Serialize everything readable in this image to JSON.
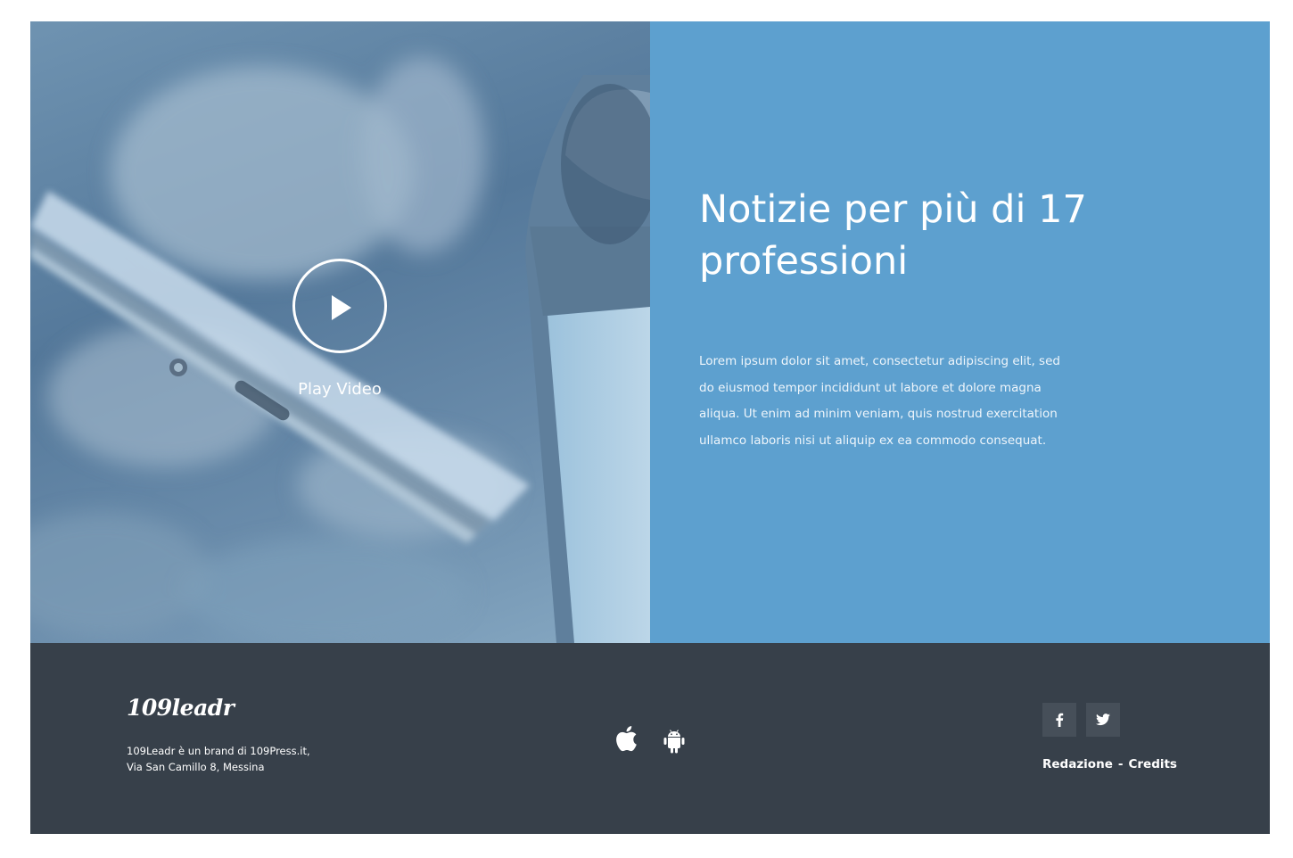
{
  "hero": {
    "play_label": "Play Video",
    "headline": "Notizie per più di 17 professioni",
    "body": "Lorem ipsum dolor sit amet, consectetur adipiscing elit, sed do eiusmod tempor incididunt ut labore et dolore magna aliqua. Ut enim ad minim veniam, quis nostrud exercitation ullamco laboris nisi ut aliquip ex ea commodo consequat."
  },
  "footer": {
    "logo": "109leadr",
    "address_line1": "109Leadr è un brand di 109Press.it,",
    "address_line2": "Via San Camillo 8, Messina",
    "store_icons": [
      "apple-icon",
      "android-icon"
    ],
    "social": [
      {
        "icon": "facebook-icon",
        "glyph": "f"
      },
      {
        "icon": "twitter-icon",
        "glyph": ""
      }
    ],
    "links": {
      "redazione": "Redazione",
      "separator": "-",
      "credits": "Credits"
    }
  },
  "colors": {
    "accent_panel": "#5da0cf",
    "footer_bg": "#37404a",
    "social_bg": "#464f59"
  }
}
